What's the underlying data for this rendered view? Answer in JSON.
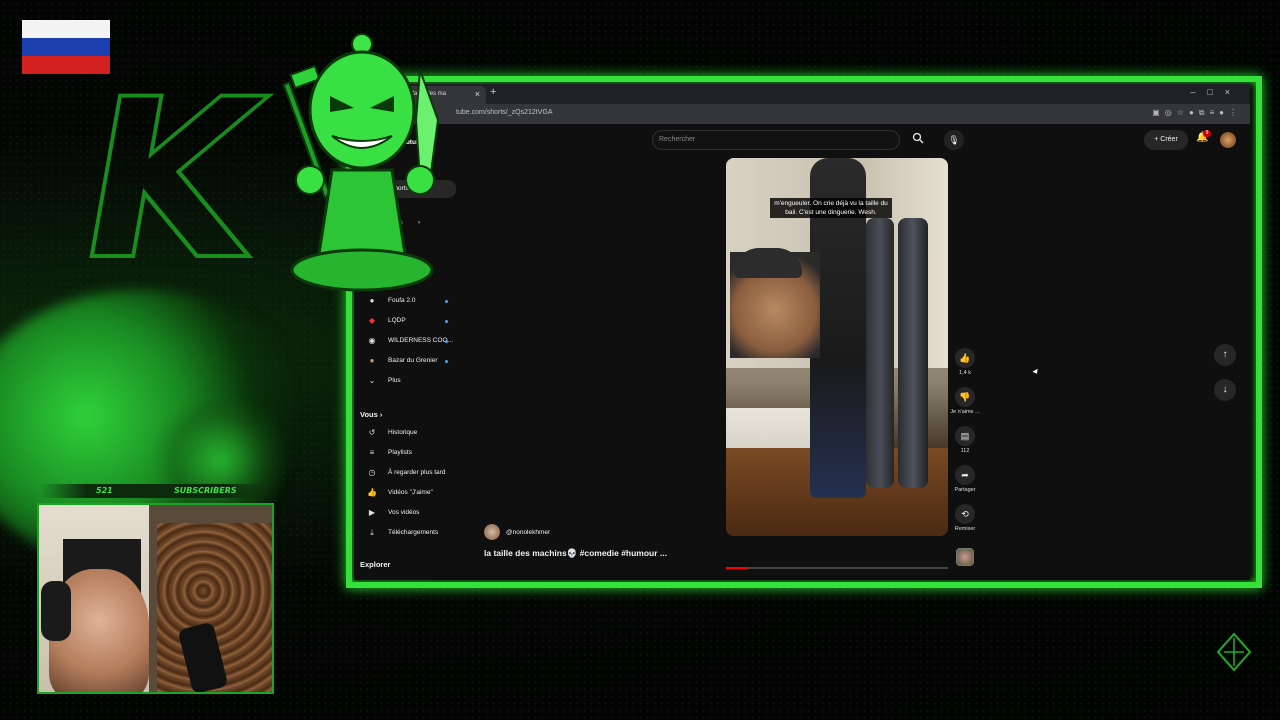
{
  "browser": {
    "tab_title": "la taille des ma",
    "url": "tube.com/shorts/_zQs212tVGA"
  },
  "youtube": {
    "search_placeholder": "Rechercher",
    "create_label": "Créer",
    "notification_count": "9",
    "sidebar": {
      "partial_items": [
        "Youtube",
        "Shorts",
        "nts",
        "se"
      ],
      "subscriptions": [
        {
          "label": "Foufa 2.0",
          "new": true
        },
        {
          "label": "LQDP",
          "new": true
        },
        {
          "label": "WILDERNESS COO...",
          "new": true
        },
        {
          "label": "Bazar du Grenier",
          "new": true
        }
      ],
      "more_label": "Plus",
      "you_header": "Vous",
      "you_items": [
        {
          "label": "Historique",
          "icon": "history-icon"
        },
        {
          "label": "Playlists",
          "icon": "playlist-icon"
        },
        {
          "label": "À regarder plus tard",
          "icon": "clock-icon"
        },
        {
          "label": "Vidéos \"J'aime\"",
          "icon": "thumbs-up-icon"
        },
        {
          "label": "Vos vidéos",
          "icon": "video-icon"
        },
        {
          "label": "Téléchargements",
          "icon": "download-icon"
        }
      ],
      "explore_header": "Explorer"
    },
    "short": {
      "caption": "m'engueuler. On crie déjà vu la taille du bail. C'est une dinguerie. Wesh.",
      "channel": "@nonolekhmer",
      "title": "la taille des machins💀 #comedie #humour ...",
      "progress": 0.1,
      "actions": {
        "like_count": "1,4 k",
        "dislike_label": "Je n'aime ...",
        "comment_count": "112",
        "share_label": "Partager",
        "remix_label": "Remixer"
      }
    }
  },
  "overlay": {
    "subscriber_count": "521",
    "subscriber_label": "SUBSCRIBERS"
  },
  "colors": {
    "accent_green": "#35e03a",
    "youtube_red": "#ff0000"
  }
}
